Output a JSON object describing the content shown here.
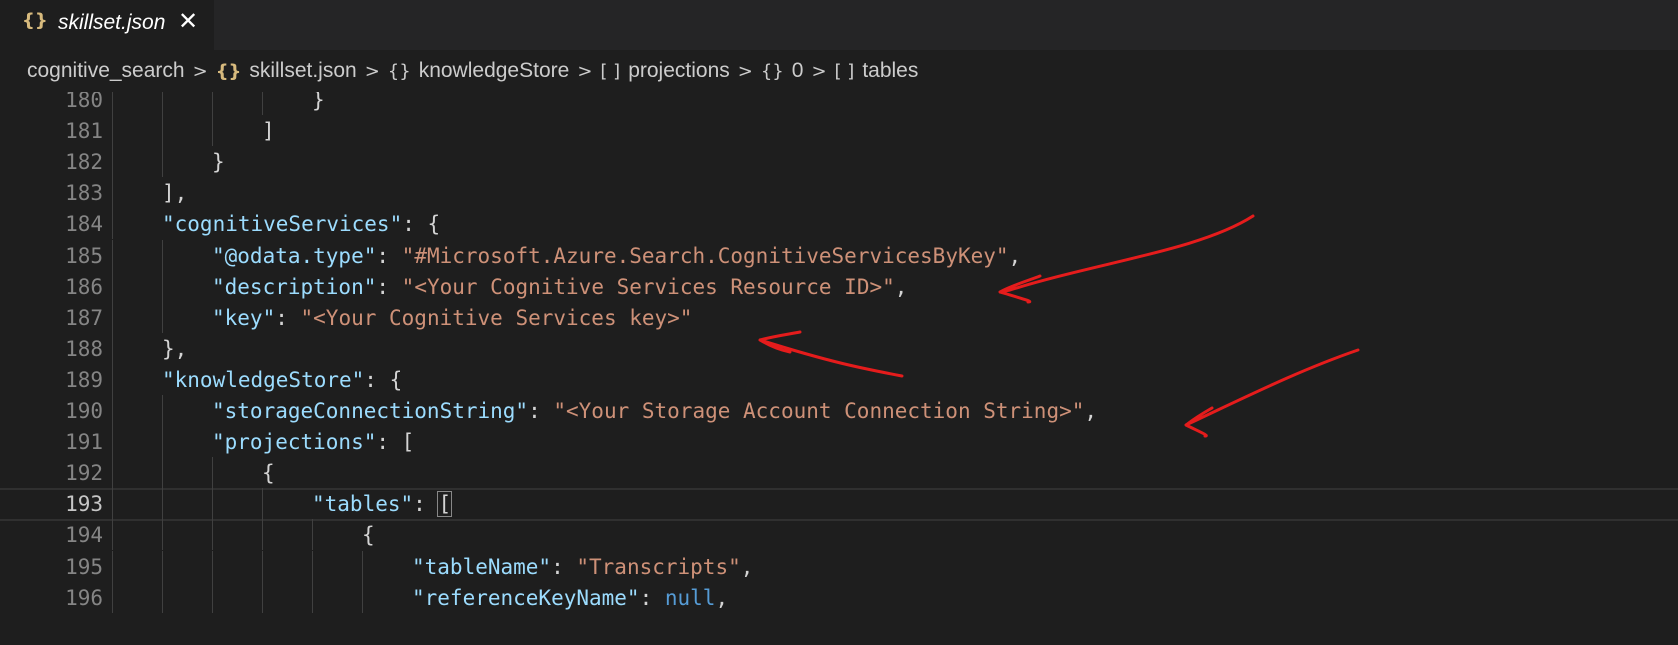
{
  "tab": {
    "icon": "{}",
    "label": "skillset.json",
    "close": "✕"
  },
  "breadcrumb": {
    "items": [
      {
        "icon": "",
        "label": "cognitive_search"
      },
      {
        "icon": "{}",
        "label": "skillset.json"
      },
      {
        "icon": "{}",
        "label": "knowledgeStore"
      },
      {
        "icon": "[ ]",
        "label": "projections"
      },
      {
        "icon": "{}",
        "label": "0"
      },
      {
        "icon": "[ ]",
        "label": "tables"
      }
    ],
    "separator": ">"
  },
  "editor": {
    "lines": [
      {
        "num": "180",
        "tokens": [
          {
            "t": "p",
            "v": "}"
          }
        ]
      },
      {
        "num": "181",
        "tokens": [
          {
            "t": "p",
            "v": "]"
          }
        ]
      },
      {
        "num": "182",
        "tokens": [
          {
            "t": "p",
            "v": "}"
          }
        ]
      },
      {
        "num": "183",
        "tokens": [
          {
            "t": "p",
            "v": "],"
          }
        ]
      },
      {
        "num": "184",
        "tokens": [
          {
            "t": "k",
            "v": "\"cognitiveServices\""
          },
          {
            "t": "p",
            "v": ": {"
          }
        ]
      },
      {
        "num": "185",
        "tokens": [
          {
            "t": "k",
            "v": "\"@odata.type\""
          },
          {
            "t": "p",
            "v": ": "
          },
          {
            "t": "s",
            "v": "\"#Microsoft.Azure.Search.CognitiveServicesByKey\""
          },
          {
            "t": "p",
            "v": ","
          }
        ]
      },
      {
        "num": "186",
        "tokens": [
          {
            "t": "k",
            "v": "\"description\""
          },
          {
            "t": "p",
            "v": ": "
          },
          {
            "t": "s",
            "v": "\"<Your Cognitive Services Resource ID>\""
          },
          {
            "t": "p",
            "v": ","
          }
        ]
      },
      {
        "num": "187",
        "tokens": [
          {
            "t": "k",
            "v": "\"key\""
          },
          {
            "t": "p",
            "v": ": "
          },
          {
            "t": "s",
            "v": "\"<Your Cognitive Services key>\""
          }
        ]
      },
      {
        "num": "188",
        "tokens": [
          {
            "t": "p",
            "v": "},"
          }
        ]
      },
      {
        "num": "189",
        "tokens": [
          {
            "t": "k",
            "v": "\"knowledgeStore\""
          },
          {
            "t": "p",
            "v": ": {"
          }
        ]
      },
      {
        "num": "190",
        "tokens": [
          {
            "t": "k",
            "v": "\"storageConnectionString\""
          },
          {
            "t": "p",
            "v": ": "
          },
          {
            "t": "s",
            "v": "\"<Your Storage Account Connection String>\""
          },
          {
            "t": "p",
            "v": ","
          }
        ]
      },
      {
        "num": "191",
        "tokens": [
          {
            "t": "k",
            "v": "\"projections\""
          },
          {
            "t": "p",
            "v": ": ["
          }
        ]
      },
      {
        "num": "192",
        "tokens": [
          {
            "t": "p",
            "v": "{"
          }
        ]
      },
      {
        "num": "193",
        "tokens": [
          {
            "t": "k",
            "v": "\"tables\""
          },
          {
            "t": "p",
            "v": ": "
          },
          {
            "t": "b",
            "v": "["
          }
        ]
      },
      {
        "num": "194",
        "tokens": [
          {
            "t": "p",
            "v": "{"
          }
        ]
      },
      {
        "num": "195",
        "tokens": [
          {
            "t": "k",
            "v": "\"tableName\""
          },
          {
            "t": "p",
            "v": ": "
          },
          {
            "t": "s",
            "v": "\"Transcripts\""
          },
          {
            "t": "p",
            "v": ","
          }
        ]
      },
      {
        "num": "196",
        "tokens": [
          {
            "t": "k",
            "v": "\"referenceKeyName\""
          },
          {
            "t": "p",
            "v": ": "
          },
          {
            "t": "n",
            "v": "null"
          },
          {
            "t": "p",
            "v": ","
          }
        ]
      }
    ],
    "current_line": "193"
  },
  "colors": {
    "key": "#9cdcfe",
    "string": "#ce9178",
    "keyword": "#569cd6",
    "annotation": "#e51c1c"
  }
}
